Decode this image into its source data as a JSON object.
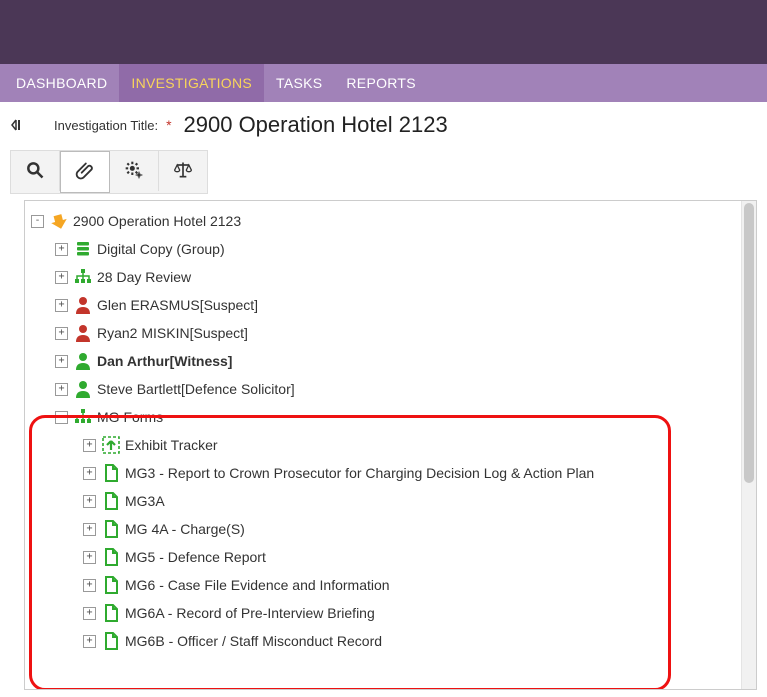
{
  "nav": {
    "items": [
      "DASHBOARD",
      "INVESTIGATIONS",
      "TASKS",
      "REPORTS"
    ],
    "active_index": 1
  },
  "title": {
    "label": "Investigation Title:",
    "required_mark": "*",
    "value": "2900 Operation Hotel 2123"
  },
  "toolbar": {
    "search": "search",
    "attach": "attachments",
    "settings": "settings",
    "scales": "legal"
  },
  "tree": {
    "root": {
      "label": "2900 Operation Hotel 2123",
      "expander": "-"
    },
    "children": [
      {
        "icon": "stack-green",
        "label": "Digital Copy (Group)",
        "expander": "+"
      },
      {
        "icon": "org-green",
        "label": "28 Day Review",
        "expander": "+"
      },
      {
        "icon": "person-red",
        "label": "Glen ERASMUS[Suspect]",
        "expander": "+"
      },
      {
        "icon": "person-red",
        "label": "Ryan2 MISKIN[Suspect]",
        "expander": "+"
      },
      {
        "icon": "person-green",
        "label": "Dan Arthur[Witness]",
        "expander": "+",
        "bold": true
      },
      {
        "icon": "person-green",
        "label": "Steve Bartlett[Defence Solicitor]",
        "expander": "+"
      },
      {
        "icon": "org-green",
        "label": "MG Forms",
        "expander": "-"
      }
    ],
    "mg_children": [
      {
        "icon": "upload-dashed",
        "label": "Exhibit Tracker",
        "expander": "+"
      },
      {
        "icon": "doc-green",
        "label": "MG3 - Report to Crown Prosecutor for Charging Decision Log & Action Plan",
        "expander": "+"
      },
      {
        "icon": "doc-green",
        "label": "MG3A",
        "expander": "+"
      },
      {
        "icon": "doc-green",
        "label": "MG 4A - Charge(S)",
        "expander": "+"
      },
      {
        "icon": "doc-green",
        "label": "MG5 - Defence Report",
        "expander": "+"
      },
      {
        "icon": "doc-green",
        "label": "MG6 - Case File Evidence and Information",
        "expander": "+"
      },
      {
        "icon": "doc-green",
        "label": "MG6A - Record of Pre-Interview Briefing",
        "expander": "+"
      },
      {
        "icon": "doc-green",
        "label": "MG6B - Officer / Staff Misconduct Record",
        "expander": "+"
      }
    ]
  }
}
